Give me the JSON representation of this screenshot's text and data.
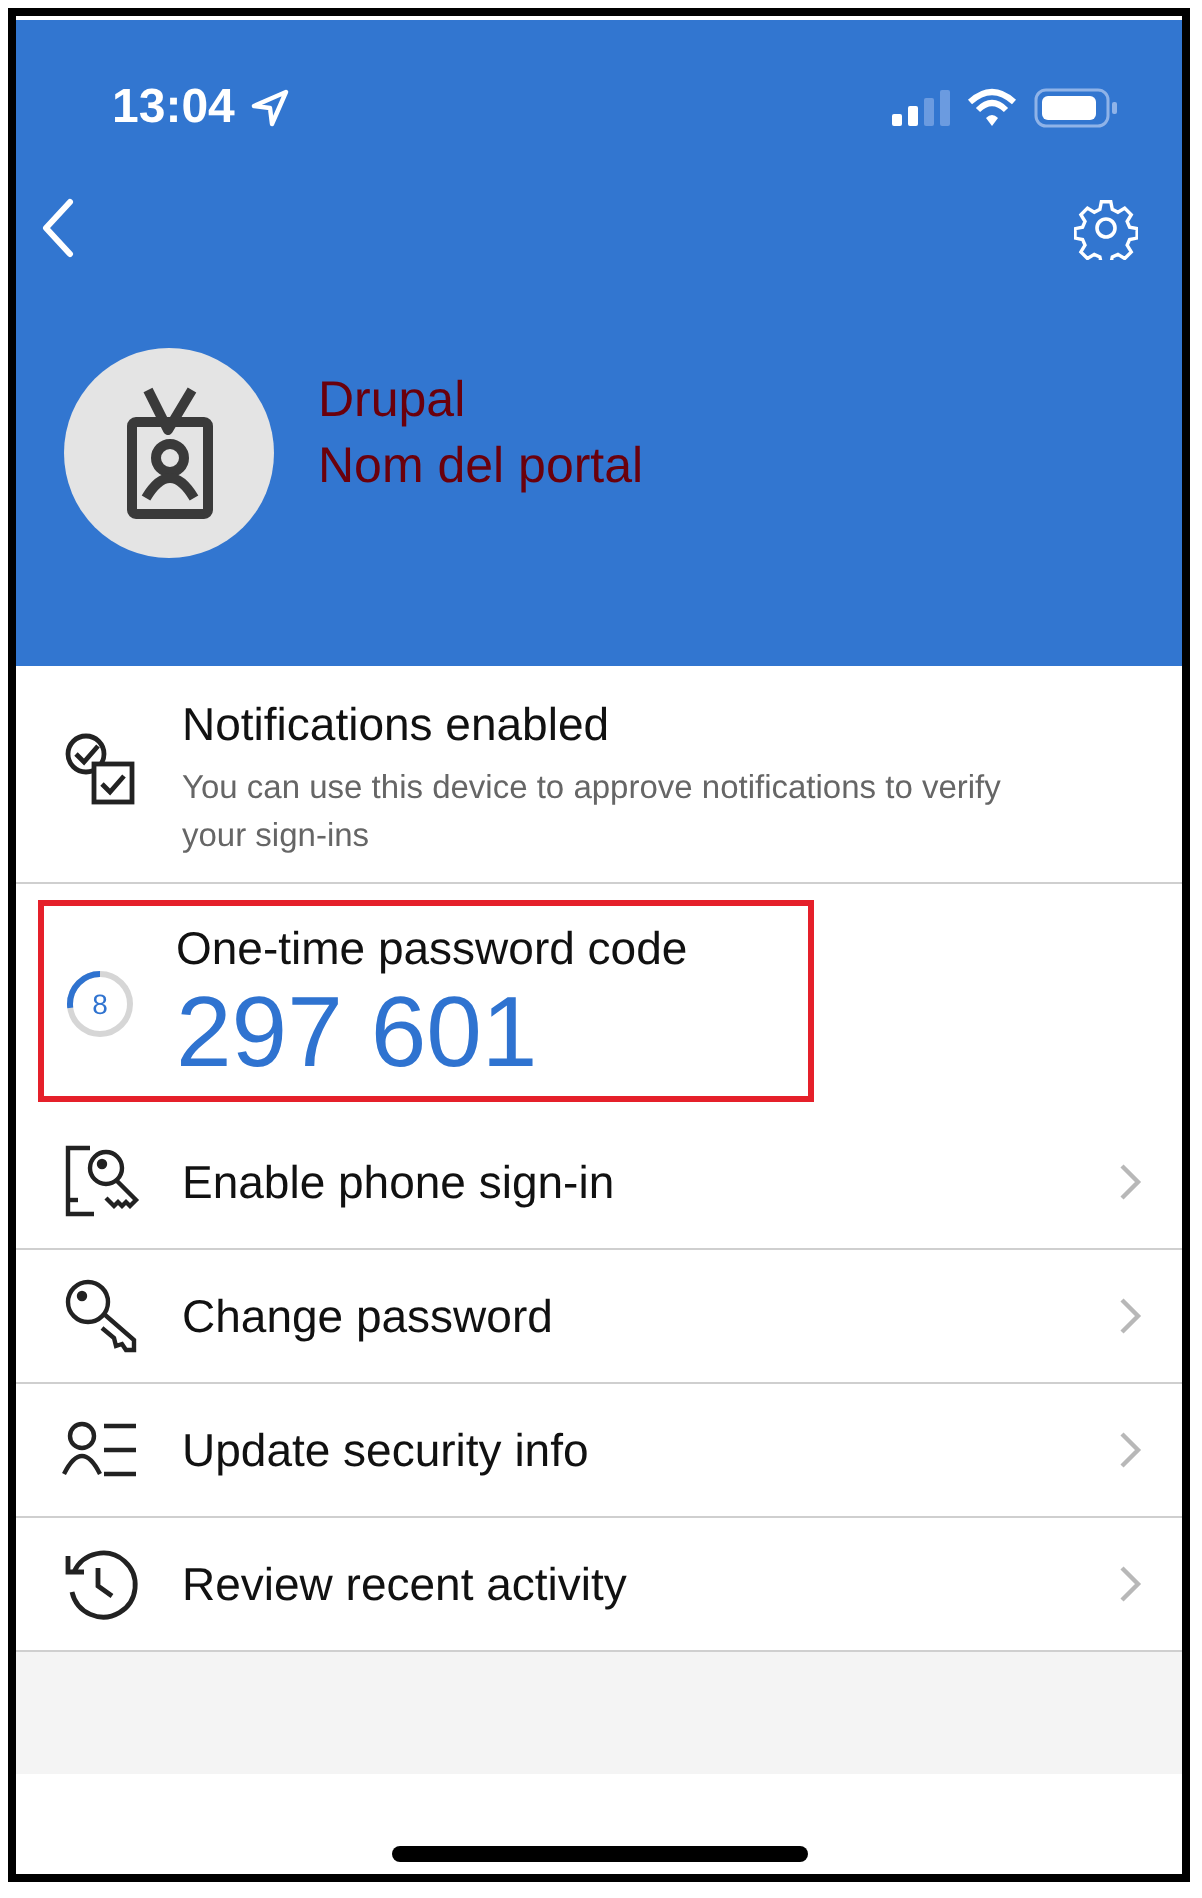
{
  "status_bar": {
    "time": "13:04"
  },
  "account": {
    "name": "Drupal",
    "portal": "Nom del portal"
  },
  "notifications": {
    "title": "Notifications enabled",
    "description": "You can use this device to approve notifications to verify your sign-ins"
  },
  "otp": {
    "label": "One-time password code",
    "code": "297 601",
    "seconds": "8",
    "level": 0.27,
    "highlighted": true
  },
  "menu": [
    {
      "label": "Enable phone sign-in"
    },
    {
      "label": "Change password"
    },
    {
      "label": "Update security info"
    },
    {
      "label": "Review recent activity"
    }
  ]
}
